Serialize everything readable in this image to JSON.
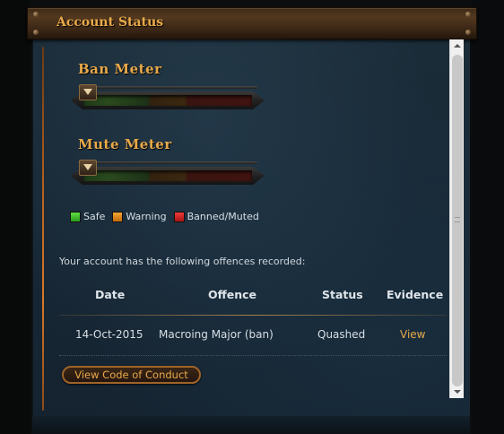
{
  "header": {
    "title": "Account Status"
  },
  "ban_meter": {
    "title": "Ban Meter"
  },
  "mute_meter": {
    "title": "Mute Meter"
  },
  "legend": [
    {
      "label": "Safe",
      "color": "#3fbf2f"
    },
    {
      "label": "Warning",
      "color": "#e58a18"
    },
    {
      "label": "Banned/Muted",
      "color": "#d42020"
    }
  ],
  "offences": {
    "intro": "Your account has the following offences recorded:",
    "columns": [
      "Date",
      "Offence",
      "Status",
      "Evidence"
    ],
    "rows": [
      {
        "date": "14-Oct-2015",
        "offence": "Macroing Major (ban)",
        "status": "Quashed",
        "evidence": "View"
      }
    ]
  },
  "actions": {
    "conduct_label": "View Code of Conduct"
  },
  "colors": {
    "accent_gold": "#e8a94a",
    "panel_bg": "#1a2a36"
  }
}
